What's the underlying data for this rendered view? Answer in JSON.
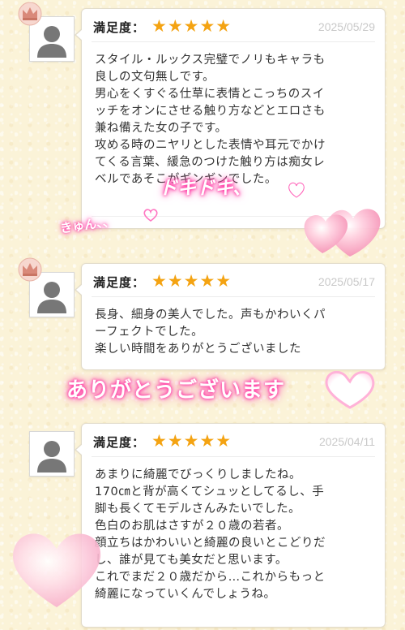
{
  "colors": {
    "star": "#f4a312",
    "date": "#c9c9c9",
    "glow": "#ff3fa6",
    "heart": "#ffb6cf"
  },
  "icons": {
    "crown": "crown-icon",
    "avatar": "user-avatar-icon",
    "heart": "heart-icon"
  },
  "reviews": [
    {
      "satisfaction_label": "満足度：",
      "stars": "★★★★★",
      "rating": 5,
      "date": "2025/05/29",
      "top_badge": true,
      "text": "スタイル・ルックス完璧でノリもキャラも\n良しの文句無しです。\n男心をくすぐる仕草に表情とこっちのスイ\nッチをオンにさせる触り方などとエロさも\n兼ね備えた女の子です。\n攻める時のニヤリとした表情や耳元でかけ\nてくる言葉、緩急のつけた触り方は痴女レ\nベルであそこがギンギンでした。"
    },
    {
      "satisfaction_label": "満足度：",
      "stars": "★★★★★",
      "rating": 5,
      "date": "2025/05/17",
      "top_badge": true,
      "text": "長身、細身の美人でした。声もかわいくパ\nーフェクトでした。\n楽しい時間をありがとうございました"
    },
    {
      "satisfaction_label": "満足度：",
      "stars": "★★★★★",
      "rating": 5,
      "date": "2025/04/11",
      "top_badge": false,
      "text": "あまりに綺麗でびっくりしましたね。\n170㎝と背が高くてシュッとしてるし、手\n脚も長くてモデルさんみたいでした。\n色白のお肌はさすが２０歳の若者。\n顔立ちはかわいいと綺麗の良いとこどりだ\nし、誰が見ても美女だと思います。\nこれでまだ２０歳だから…これからもっと\n綺麗になっていくんでしょうね。"
    }
  ],
  "decorations": {
    "dokidoki": "ドキドキ、",
    "kyun": "きゅん、、",
    "arigato": "ありがとうございます"
  }
}
